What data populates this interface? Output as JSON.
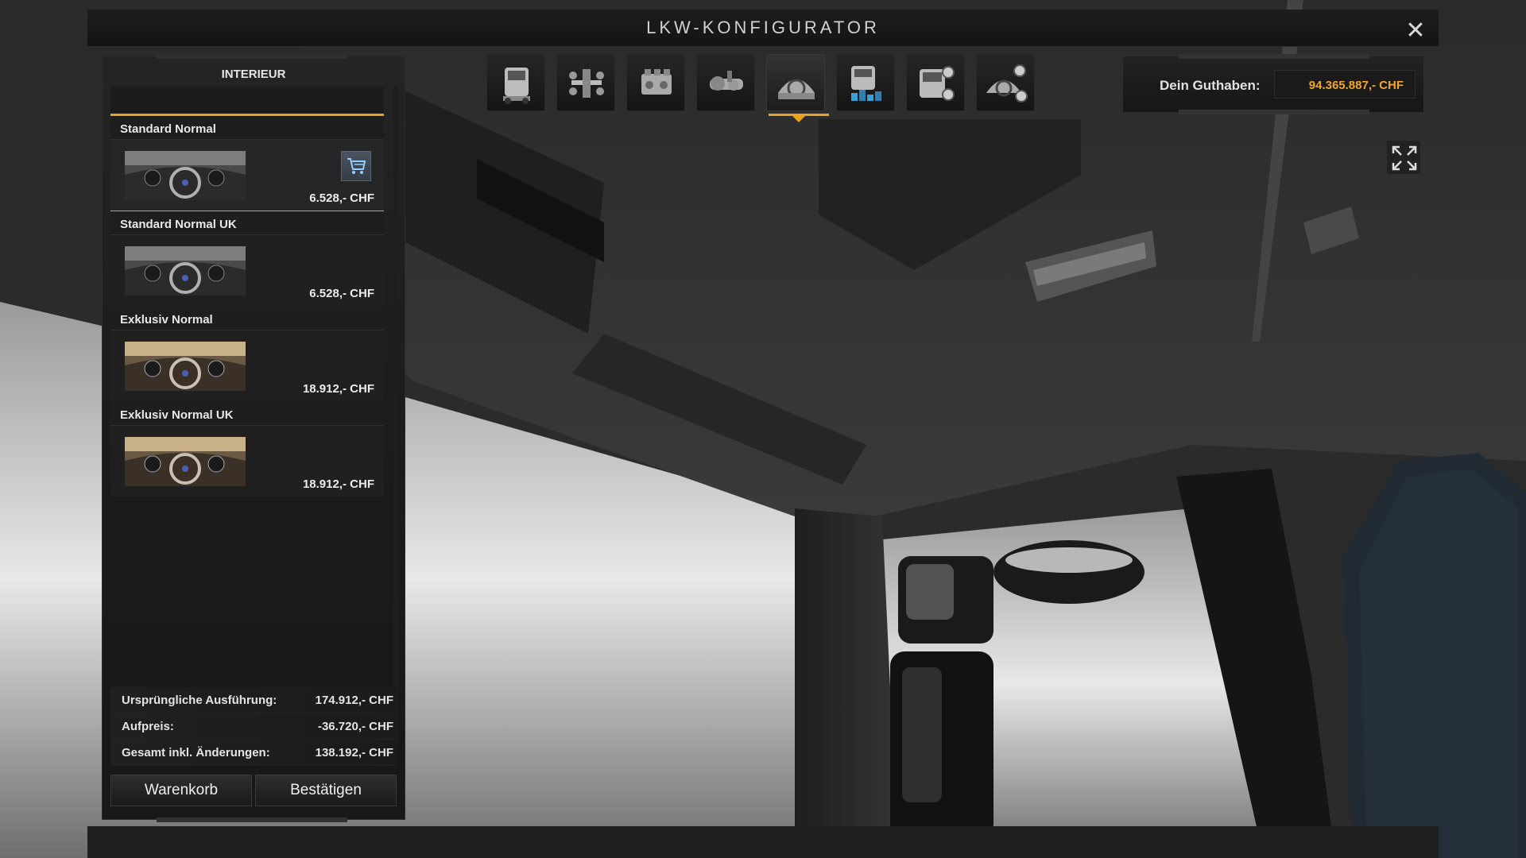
{
  "header": {
    "title": "LKW-KONFIGURATOR",
    "close_icon": "close-icon"
  },
  "categories": [
    {
      "icon": "truck-cab-icon",
      "active": false
    },
    {
      "icon": "chassis-icon",
      "active": false
    },
    {
      "icon": "engine-icon",
      "active": false
    },
    {
      "icon": "transmission-icon",
      "active": false
    },
    {
      "icon": "interior-icon",
      "active": true
    },
    {
      "icon": "paint-icon",
      "active": false
    },
    {
      "icon": "cab-accessories-icon",
      "active": false
    },
    {
      "icon": "interior-accessories-icon",
      "active": false
    }
  ],
  "balance": {
    "label": "Dein Guthaben:",
    "value": "94.365.887,- CHF"
  },
  "panel": {
    "title": "INTERIEUR",
    "items": [
      {
        "name": "Standard Normal",
        "price": "6.528,- CHF",
        "selected": true,
        "in_cart": true,
        "trim": "dark"
      },
      {
        "name": "Standard Normal UK",
        "price": "6.528,- CHF",
        "selected": false,
        "in_cart": false,
        "trim": "dark"
      },
      {
        "name": "Exklusiv Normal",
        "price": "18.912,- CHF",
        "selected": false,
        "in_cart": false,
        "trim": "beige"
      },
      {
        "name": "Exklusiv Normal UK",
        "price": "18.912,- CHF",
        "selected": false,
        "in_cart": false,
        "trim": "beige"
      }
    ]
  },
  "summary": {
    "original_label": "Ursprüngliche Ausführung:",
    "original_value": "174.912,- CHF",
    "surcharge_label": "Aufpreis:",
    "surcharge_value": "-36.720,- CHF",
    "total_label": "Gesamt inkl. Änderungen:",
    "total_value": "138.192,- CHF"
  },
  "buttons": {
    "cart": "Warenkorb",
    "confirm": "Bestätigen"
  },
  "colors": {
    "accent": "#e9a21b",
    "balance": "#f0a826",
    "panel_bg": "#1e1e1e"
  }
}
